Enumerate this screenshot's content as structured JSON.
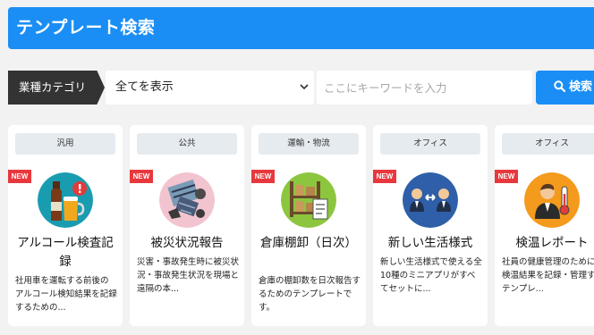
{
  "header": {
    "title": "テンプレート検索"
  },
  "filter": {
    "category_label": "業種カテゴリ",
    "selected_option": "全てを表示",
    "search_placeholder": "ここにキーワードを入力",
    "search_button": "検索"
  },
  "cards": [
    {
      "tag": "汎用",
      "badge": "NEW",
      "title": "アルコール検査記録",
      "desc": "社用車を運転する前後のアルコール検知結果を記録するための...",
      "icon": "beer-bottle-icon"
    },
    {
      "tag": "公共",
      "badge": "NEW",
      "title": "被災状況報告",
      "desc": "災害・事故発生時に被災状況・事故発生状況を現場と遠隔の本...",
      "icon": "disaster-debris-icon"
    },
    {
      "tag": "運輸・物流",
      "badge": "NEW",
      "title": "倉庫棚卸（日次）",
      "desc": "倉庫の棚卸数を日次報告するためのテンプレートです。",
      "icon": "warehouse-shelf-icon"
    },
    {
      "tag": "オフィス",
      "badge": "NEW",
      "title": "新しい生活様式",
      "desc": "新しい生活様式で使える全10種のミニアプリがすべてセットに...",
      "icon": "social-distance-icon"
    },
    {
      "tag": "オフィス",
      "badge": "NEW",
      "title": "検温レポート",
      "desc": "社員の健康管理のために、検温結果を記録・管理するテンプレ...",
      "icon": "thermometer-person-icon"
    }
  ],
  "colors": {
    "accent": "#1a8ef5",
    "badge": "#e8383d",
    "dark_label": "#333333"
  }
}
